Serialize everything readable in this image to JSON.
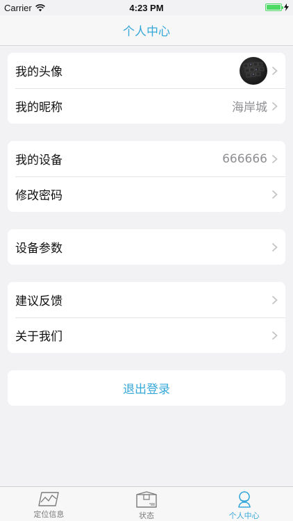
{
  "status_bar": {
    "carrier": "Carrier",
    "time": "4:23 PM"
  },
  "nav": {
    "title": "个人中心"
  },
  "groups": [
    {
      "rows": [
        {
          "label": "我的头像",
          "value": ""
        },
        {
          "label": "我的昵称",
          "value": "海岸城"
        }
      ]
    },
    {
      "rows": [
        {
          "label": "我的设备",
          "value": "666666"
        },
        {
          "label": "修改密码",
          "value": ""
        }
      ]
    },
    {
      "rows": [
        {
          "label": "设备参数",
          "value": ""
        }
      ]
    },
    {
      "rows": [
        {
          "label": "建议反馈",
          "value": ""
        },
        {
          "label": "关于我们",
          "value": ""
        }
      ]
    }
  ],
  "logout": {
    "label": "退出登录"
  },
  "tabs": [
    {
      "label": "定位信息",
      "icon": "map-icon",
      "active": false
    },
    {
      "label": "状态",
      "icon": "package-icon",
      "active": false
    },
    {
      "label": "个人中心",
      "icon": "person-icon",
      "active": true
    }
  ],
  "colors": {
    "accent": "#35a7d8",
    "battery": "#4cd964"
  }
}
